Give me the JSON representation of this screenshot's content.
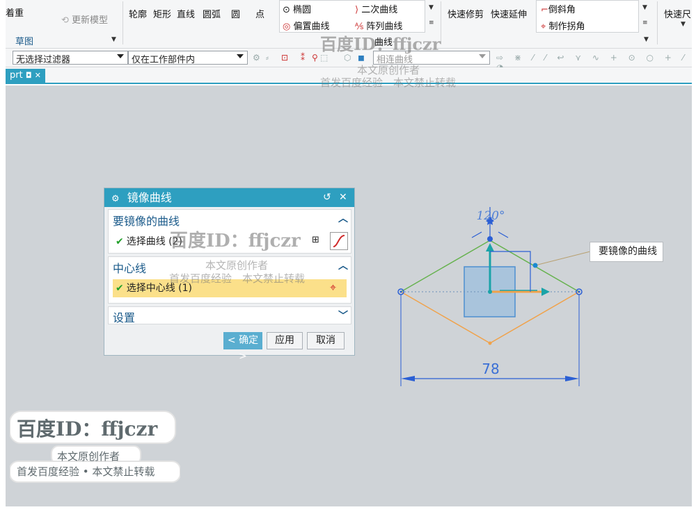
{
  "ribbon": {
    "tab_partial": "着重",
    "update_model": "更新模型",
    "group_label": "草图",
    "curve_tools": [
      "轮廓",
      "矩形",
      "直线",
      "圆弧",
      "圆",
      "点"
    ],
    "ellipse": "椭圆",
    "conic": "二次曲线",
    "offset_curve": "偏置曲线",
    "pattern_curve": "阵列曲线",
    "mirror_curve": "曲线",
    "quick_trim": "快速修剪",
    "quick_extend": "快速延伸",
    "chamfer": "倒斜角",
    "make_corner": "制作拐角",
    "quick_size": "快速尺"
  },
  "filterbar": {
    "selection_filter": "无选择过滤器",
    "scope": "仅在工作部件内",
    "curve_rule": "相连曲线"
  },
  "tab": {
    "name": "prt"
  },
  "dialog": {
    "title": "镜像曲线",
    "section_curves": "要镜像的曲线",
    "select_curves": "选择曲线 (2)",
    "section_centerline": "中心线",
    "select_centerline": "选择中心线 (1)",
    "section_settings": "设置",
    "ok_label": "< 确定 >",
    "apply_label": "应用",
    "cancel_label": "取消"
  },
  "sketch": {
    "dimension_width": "78",
    "angle_label": "120°",
    "callout_label": "要镜像的曲线",
    "colors": {
      "mirror_source": "#66b24e",
      "mirrored": "#f0a24a",
      "dimension": "#2b5fd4",
      "axis": "#1aa3a8"
    }
  },
  "watermarks": {
    "top_id": "百度ID：ffjczr",
    "top_line1": "本文原创作者",
    "top_line2": "首发百度经验　本文禁止转载",
    "mid_id": "百度ID：ffjczr",
    "mid_line1": "本文原创作者",
    "mid_line2": "首发百度经验　本文禁止转载",
    "stamp_id": "百度ID：ffjczr",
    "stamp_line1": "本文原创作者",
    "stamp_line2": "首发百度经验 • 本文禁止转载"
  }
}
